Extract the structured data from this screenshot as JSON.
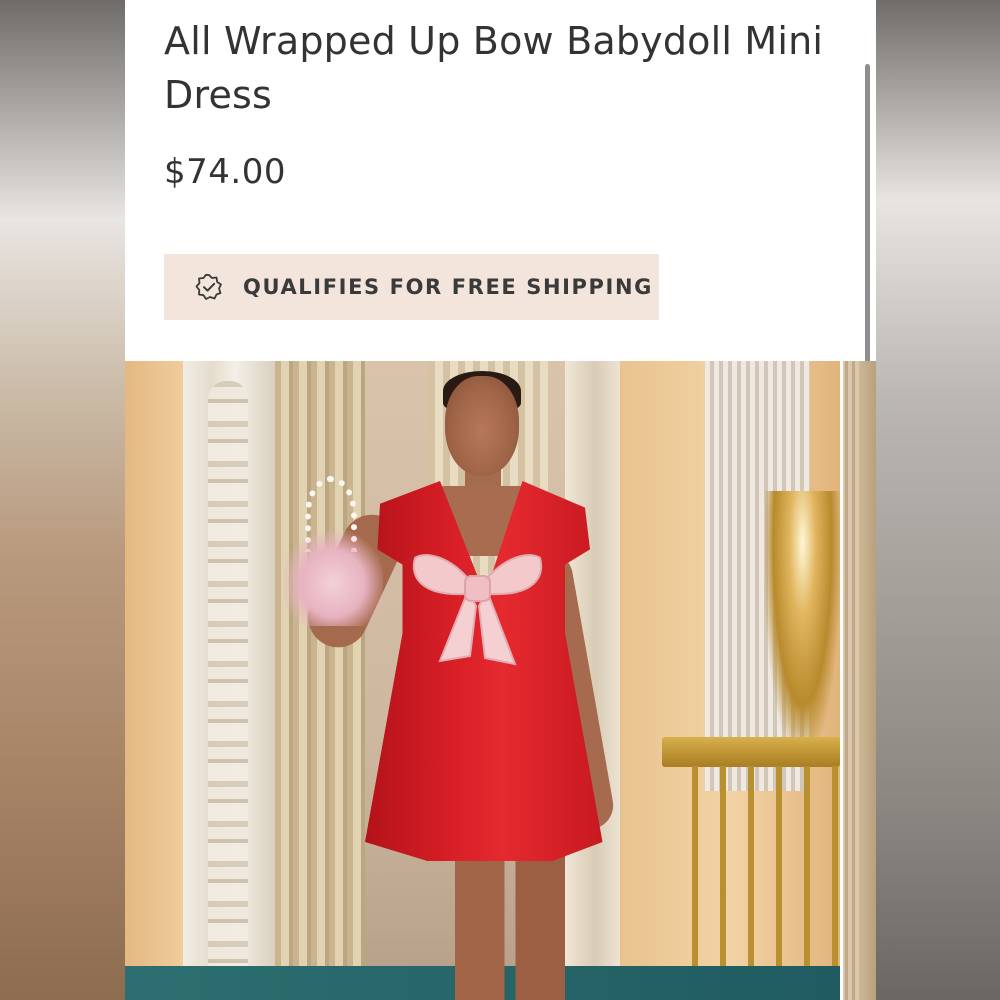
{
  "product": {
    "title": "All Wrapped Up Bow Babydoll Mini Dress",
    "price": "$74.00",
    "shipping_badge": "QUALIFIES FOR FREE SHIPPING"
  },
  "icons": {
    "shipping_badge_icon": "verified-badge-check-icon"
  },
  "colors": {
    "badge_background": "#f3e4dc",
    "text": "#333333",
    "dress_red": "#d81f26",
    "bow_pink": "#f3c9cc"
  }
}
